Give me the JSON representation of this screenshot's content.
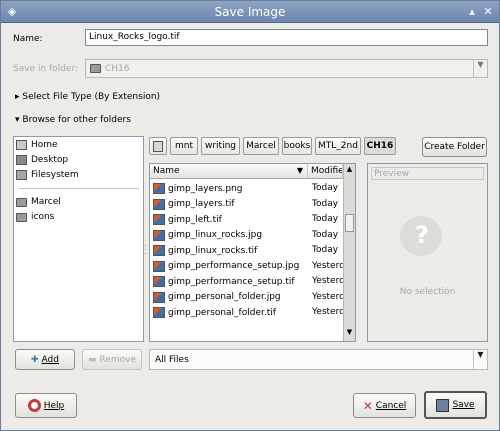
{
  "window": {
    "title": "Save Image"
  },
  "name_field": {
    "label": "Name:",
    "value": "Linux_Rocks_logo.tif"
  },
  "save_in": {
    "label": "Save in folder:",
    "value": "CH16"
  },
  "expanders": {
    "file_type": "Select File Type (By Extension)",
    "browse": "Browse for other folders"
  },
  "places": [
    {
      "label": "Home",
      "icon": "home-icon"
    },
    {
      "label": "Desktop",
      "icon": "desktop-icon"
    },
    {
      "label": "Filesystem",
      "icon": "filesystem-icon"
    }
  ],
  "bookmarks": [
    {
      "label": "Marcel",
      "icon": "folder-icon"
    },
    {
      "label": "icons",
      "icon": "folder-icon"
    }
  ],
  "path_buttons": [
    "mnt",
    "writing",
    "Marcel",
    "books",
    "MTL_2nd",
    "CH16"
  ],
  "create_folder": "Create Folder",
  "file_list": {
    "columns": {
      "name": "Name",
      "modified": "Modified"
    },
    "rows": [
      {
        "name": "gimp_layers.png",
        "modified": "Today"
      },
      {
        "name": "gimp_layers.tif",
        "modified": "Today"
      },
      {
        "name": "gimp_left.tif",
        "modified": "Today"
      },
      {
        "name": "gimp_linux_rocks.jpg",
        "modified": "Today"
      },
      {
        "name": "gimp_linux_rocks.tif",
        "modified": "Today"
      },
      {
        "name": "gimp_performance_setup.jpg",
        "modified": "Yesterday"
      },
      {
        "name": "gimp_performance_setup.tif",
        "modified": "Yesterday"
      },
      {
        "name": "gimp_personal_folder.jpg",
        "modified": "Yesterday"
      },
      {
        "name": "gimp_personal_folder.tif",
        "modified": "Yesterday"
      }
    ]
  },
  "preview": {
    "header": "Preview",
    "empty": "No selection"
  },
  "add_button": "Add",
  "remove_button": "Remove",
  "filter": {
    "value": "All Files"
  },
  "help_button": "Help",
  "cancel_button": "Cancel",
  "save_button": "Save",
  "colors": {
    "titlebar": "#6d86ae",
    "window_bg": "#ecebe8",
    "selection": "#ffffff"
  }
}
